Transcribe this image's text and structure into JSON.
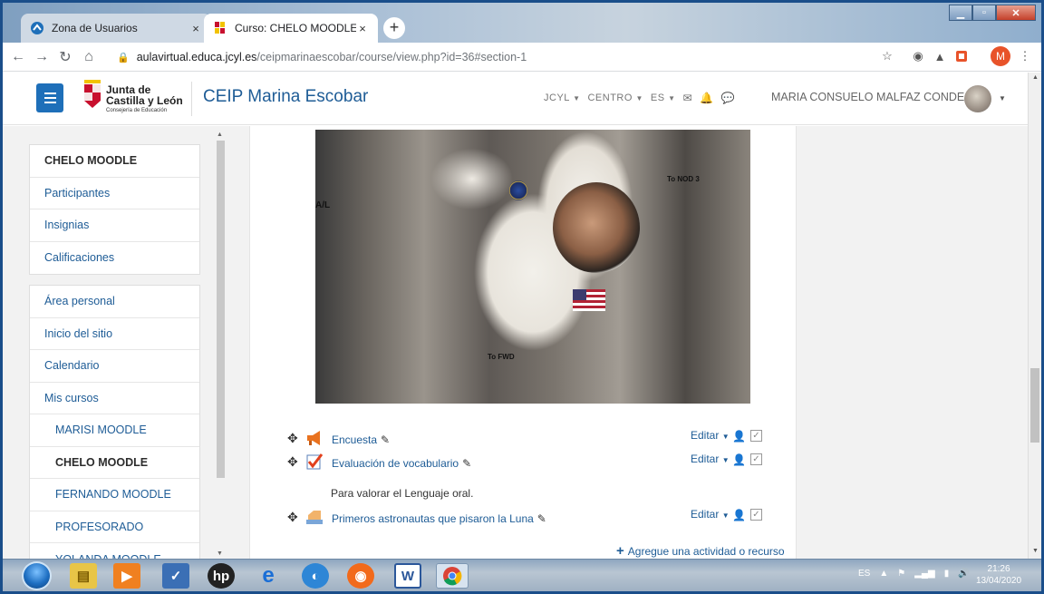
{
  "browser": {
    "tabs": [
      {
        "title": "Zona de Usuarios",
        "close": "×"
      },
      {
        "title": "Curso: CHELO MOODLE",
        "close": "×"
      }
    ],
    "new_tab": "+",
    "url_host": "aulavirtual.educa.jcyl.es",
    "url_path": "/ceipmarinaescobar/course/view.php?id=36#section-1",
    "profile_initial": "M"
  },
  "header": {
    "logo_line1": "Junta de",
    "logo_line2": "Castilla y León",
    "logo_line3": "Consejería de Educación",
    "site_name": "CEIP Marina Escobar",
    "menus": [
      "JCYL",
      "CENTRO",
      "ES"
    ],
    "user_name": "MARIA CONSUELO MALFAZ CONDE"
  },
  "drawer": {
    "group1": [
      "CHELO MOODLE",
      "Participantes",
      "Insignias",
      "Calificaciones"
    ],
    "group2": [
      "Área personal",
      "Inicio del sitio",
      "Calendario",
      "Mis cursos"
    ],
    "courses": [
      "MARISI MOODLE",
      "CHELO MOODLE",
      "FERNANDO MOODLE",
      "PROFESORADO",
      "YOLANDA MOODLE"
    ]
  },
  "photo": {
    "sign1": "To NOD 3",
    "sign2": "A/L",
    "sign3": "To FWD"
  },
  "activities": [
    {
      "name": "Encuesta",
      "edit": "Editar"
    },
    {
      "name": "Evaluación de vocabulario",
      "edit": "Editar",
      "description": "Para valorar el Lenguaje oral."
    },
    {
      "name": "Primeros astronautas que pisaron la Luna",
      "edit": "Editar"
    }
  ],
  "add_resource": "Agregue una actividad o recurso",
  "taskbar": {
    "language": "ES",
    "time": "21:26",
    "date": "13/04/2020"
  }
}
